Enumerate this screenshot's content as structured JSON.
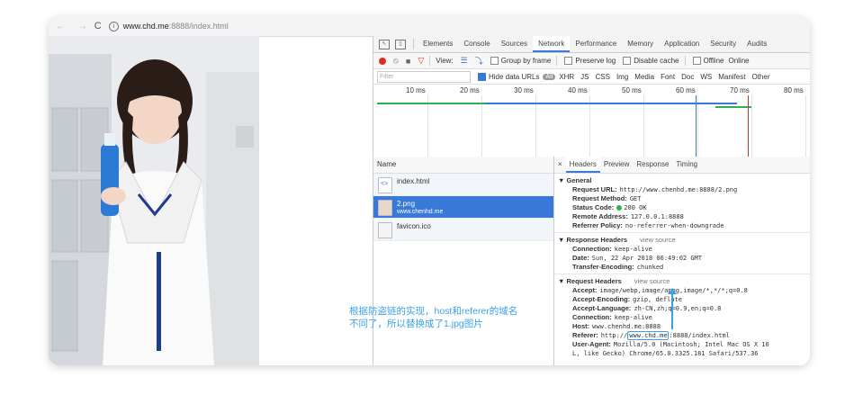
{
  "browser": {
    "nav_glyphs": "← →",
    "reload_glyph": "C",
    "info_glyph": "i",
    "url_host": "www.chd.me",
    "url_rest": ":8888/index.html"
  },
  "devtools": {
    "tabs": [
      "Elements",
      "Console",
      "Sources",
      "Network",
      "Performance",
      "Memory",
      "Application",
      "Security",
      "Audits"
    ],
    "active_tab": "Network",
    "toolbar": {
      "view_label": "View:",
      "group_by_frame": "Group by frame",
      "preserve_log": "Preserve log",
      "disable_cache": "Disable cache",
      "offline": "Offline",
      "online": "Online"
    },
    "filter": {
      "placeholder": "Filter",
      "hide_data_urls": "Hide data URLs",
      "all": "All",
      "types": [
        "XHR",
        "JS",
        "CSS",
        "Img",
        "Media",
        "Font",
        "Doc",
        "WS",
        "Manifest",
        "Other"
      ]
    },
    "timeline_ticks": [
      "10 ms",
      "20 ms",
      "30 ms",
      "40 ms",
      "50 ms",
      "60 ms",
      "70 ms",
      "80 ms"
    ],
    "name_header": "Name",
    "requests": [
      {
        "name": "index.html",
        "domain": ""
      },
      {
        "name": "2.png",
        "domain": "www.chenhd.me"
      },
      {
        "name": "favicon.ico",
        "domain": ""
      }
    ],
    "detail_close": "×",
    "detail_tabs": [
      "Headers",
      "Preview",
      "Response",
      "Timing"
    ],
    "general": {
      "title": "▼ General",
      "request_url_k": "Request URL:",
      "request_url_v": "http://www.chenhd.me:8888/2.png",
      "method_k": "Request Method:",
      "method_v": "GET",
      "status_k": "Status Code:",
      "status_v": "200 OK",
      "remote_k": "Remote Address:",
      "remote_v": "127.0.0.1:8888",
      "referrer_k": "Referrer Policy:",
      "referrer_v": "no-referrer-when-downgrade"
    },
    "response_headers": {
      "title": "▼ Response Headers",
      "view_source": "view source",
      "connection_k": "Connection:",
      "connection_v": "keep-alive",
      "date_k": "Date:",
      "date_v": "Sun, 22 Apr 2018 06:49:02 GMT",
      "te_k": "Transfer-Encoding:",
      "te_v": "chunked"
    },
    "request_headers": {
      "title": "▼ Request Headers",
      "view_source": "view source",
      "accept_k": "Accept:",
      "accept_v": "image/webp,image/apng,image/*,*/*;q=0.8",
      "enc_k": "Accept-Encoding:",
      "enc_v": "gzip, deflate",
      "lang_k": "Accept-Language:",
      "lang_v": "zh-CN,zh;q=0.9,en;q=0.8",
      "conn_k": "Connection:",
      "conn_v": "keep-alive",
      "host_k": "Host:",
      "host_v": "www.chenhd.me:8888",
      "referer_k": "Referer:",
      "referer_pre": "http://",
      "referer_hl": "www.chd.me",
      "referer_post": ":8888/index.html",
      "ua_k": "User-Agent:",
      "ua_v1": "Mozilla/5.0 (Macintosh; Intel Mac OS X 10",
      "ua_v2": "L, like Gecko) Chrome/65.0.3325.181 Safari/537.36"
    }
  },
  "annotation": {
    "line1": "根据防盗链的实现，host和referer的域名",
    "line2": "不同了，所以替换成了1.jpg图片"
  },
  "colors": {
    "accent": "#3879d9",
    "annotation": "#3aa0e8",
    "record": "#d93025",
    "status_ok": "#2bb24c"
  }
}
